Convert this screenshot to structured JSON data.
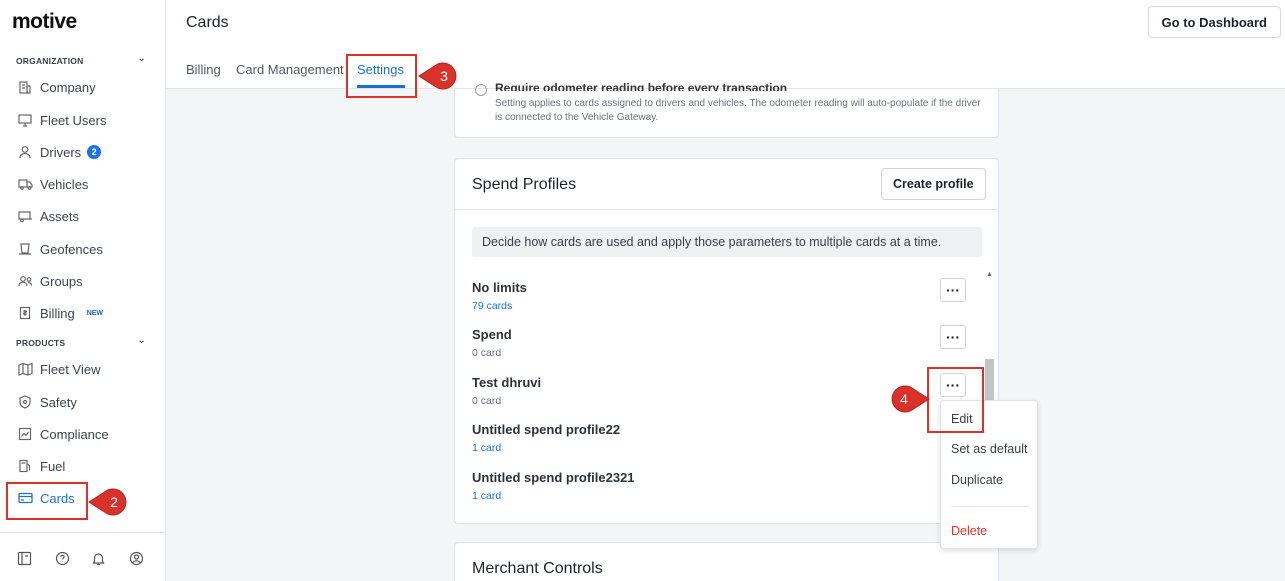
{
  "brand": {
    "logo_text": "motive"
  },
  "sidebar": {
    "organization_label": "ORGANIZATION",
    "products_label": "PRODUCTS",
    "org_items": [
      {
        "label": "Company",
        "icon": "building-icon"
      },
      {
        "label": "Fleet Users",
        "icon": "monitor-icon"
      },
      {
        "label": "Drivers",
        "icon": "person-icon",
        "badge": "2"
      },
      {
        "label": "Vehicles",
        "icon": "truck-icon"
      },
      {
        "label": "Assets",
        "icon": "trailer-icon"
      },
      {
        "label": "Geofences",
        "icon": "geofence-icon"
      },
      {
        "label": "Groups",
        "icon": "groups-icon"
      },
      {
        "label": "Billing",
        "icon": "billing-icon",
        "tag": "NEW"
      }
    ],
    "product_items": [
      {
        "label": "Fleet View",
        "icon": "map-icon"
      },
      {
        "label": "Safety",
        "icon": "shield-icon"
      },
      {
        "label": "Compliance",
        "icon": "compliance-icon"
      },
      {
        "label": "Fuel",
        "icon": "fuel-icon"
      },
      {
        "label": "Cards",
        "icon": "card-icon",
        "active": true
      }
    ],
    "bottom_icons": [
      "book-icon",
      "help-icon",
      "bell-icon",
      "account-icon"
    ]
  },
  "header": {
    "title": "Cards",
    "dashboard_button": "Go to Dashboard",
    "tabs": [
      {
        "label": "Billing"
      },
      {
        "label": "Card Management"
      },
      {
        "label": "Settings",
        "active": true
      }
    ]
  },
  "odometer_setting": {
    "title": "Require odometer reading before every transaction",
    "description": "Setting applies to cards assigned to drivers and vehicles. The odometer reading will auto-populate if the driver is connected to the Vehicle Gateway."
  },
  "spend_profiles": {
    "title": "Spend Profiles",
    "create_button": "Create profile",
    "info": "Decide how cards are used and apply those parameters to multiple cards at a time.",
    "more_label": "···",
    "items": [
      {
        "name": "No limits",
        "count": "79 cards"
      },
      {
        "name": "Spend",
        "count": "0 card"
      },
      {
        "name": "Test dhruvi",
        "count": "0 card"
      },
      {
        "name": "Untitled spend profile22",
        "count": "1 card"
      },
      {
        "name": "Untitled spend profile2321",
        "count": "1 card"
      }
    ]
  },
  "merchant_controls": {
    "title": "Merchant Controls"
  },
  "dropdown": {
    "edit": "Edit",
    "set_default": "Set as default",
    "duplicate": "Duplicate",
    "delete": "Delete"
  },
  "annotations": [
    "2",
    "3",
    "4"
  ],
  "colors": {
    "accent": "#1a6fd1",
    "annotation": "#d9322b",
    "danger": "#e0352c"
  }
}
